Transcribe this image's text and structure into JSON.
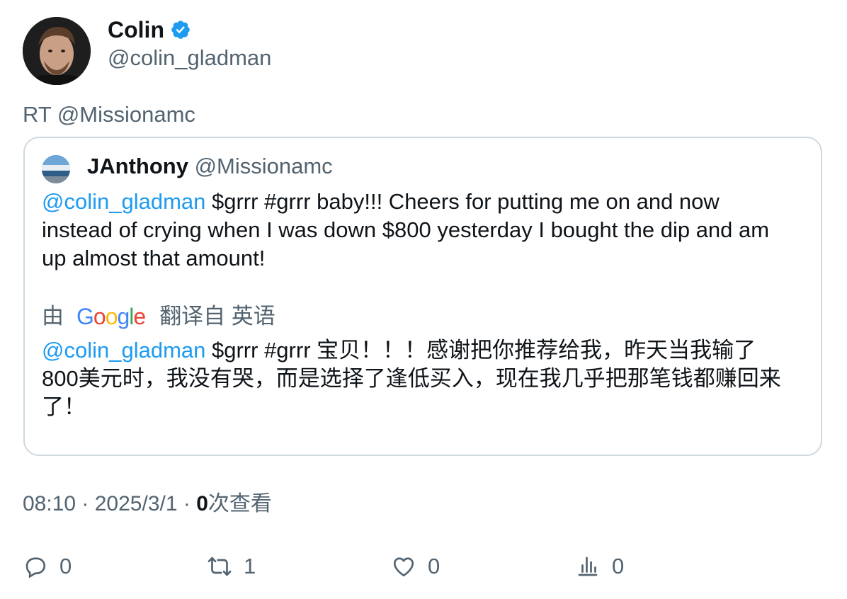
{
  "author": {
    "display_name": "Colin",
    "handle": "@colin_gladman",
    "verified_icon": "verified-badge-icon"
  },
  "retweet_line": "RT @Missionamc",
  "quote": {
    "display_name": "JAnthony",
    "handle": "@Missionamc",
    "mention": "@colin_gladman",
    "text_line_1": " $grrr #grrr baby!!! Cheers for putting me on and now",
    "text_line_2": "instead of crying when I was down $800  yesterday I bought the dip and am",
    "text_line_3": "up almost that amount!",
    "translate_prefix": "由",
    "google_logo": "Google",
    "translate_suffix": "翻译自 英语",
    "translated_mention": "@colin_gladman",
    "translated_line_1": " $grrr #grrr 宝贝！！！感谢把你推荐给我，昨天当我输了",
    "translated_line_2": "800美元时，我没有哭，而是选择了逢低买入，现在我几乎把那笔钱都赚回来",
    "translated_line_3": "了！"
  },
  "meta": {
    "time": "08:10",
    "sep1": " · ",
    "date": "2025/3/1",
    "sep2": " · ",
    "views_count": "0",
    "views_label": "次查看"
  },
  "actions": {
    "reply_count": "0",
    "retweet_count": "1",
    "like_count": "0",
    "views_count": "0"
  },
  "colors": {
    "link": "#1d9bf0",
    "secondary_text": "#536471",
    "border": "#cfd9de"
  }
}
